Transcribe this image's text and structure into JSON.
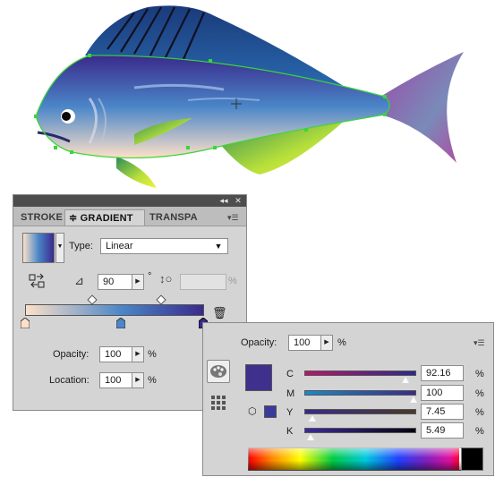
{
  "colors": {
    "gradient_start": "#fde0c8",
    "gradient_mid": "#4a86c8",
    "gradient_end": "#3a2a8c",
    "selected_swatch": "#40308e",
    "panel_bg": "#d4d4d4"
  },
  "gradient_panel": {
    "tabs": [
      {
        "label": "STROKE"
      },
      {
        "label": "≑ GRADIENT"
      },
      {
        "label": "TRANSPA"
      }
    ],
    "type_label": "Type:",
    "type_value": "Linear",
    "angle_value": "90",
    "degree_symbol": "°",
    "aspect_unit": "%",
    "opacity_label": "Opacity:",
    "opacity_value": "100",
    "opacity_unit": "%",
    "location_label": "Location:",
    "location_value": "100",
    "location_unit": "%"
  },
  "color_panel": {
    "opacity_label": "Opacity:",
    "opacity_value": "100",
    "opacity_unit": "%",
    "channels": [
      {
        "name": "C",
        "value": "92.16",
        "unit": "%",
        "level": 0.9216
      },
      {
        "name": "M",
        "value": "100",
        "unit": "%",
        "level": 1.0
      },
      {
        "name": "Y",
        "value": "7.45",
        "unit": "%",
        "level": 0.0745
      },
      {
        "name": "K",
        "value": "5.49",
        "unit": "%",
        "level": 0.0549
      }
    ]
  }
}
